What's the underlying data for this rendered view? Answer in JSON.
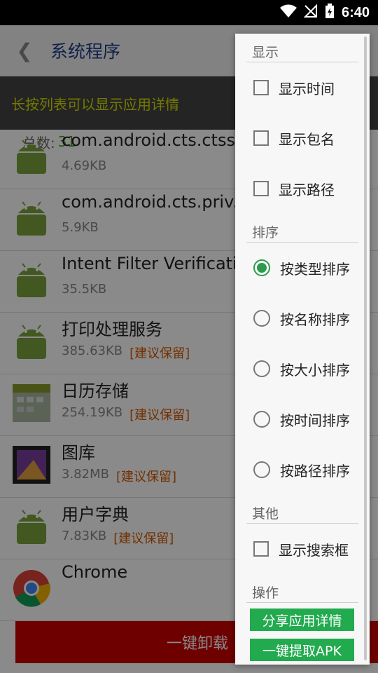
{
  "status_bar": {
    "time": "6:40"
  },
  "toolbar": {
    "back_icon": "chevron-left-icon",
    "title": "系统程序"
  },
  "hint": "长按列表可以显示应用详情",
  "count": {
    "label": "总数:",
    "value": "31"
  },
  "apps": [
    {
      "name": "com.android.cts.ctss",
      "size": "4.69KB",
      "tag": "",
      "icon": "android-icon"
    },
    {
      "name": "com.android.cts.priv.",
      "size": "5.9KB",
      "tag": "",
      "icon": "android-icon"
    },
    {
      "name": "Intent Filter Verificati",
      "size": "35.5KB",
      "tag": "",
      "icon": "android-icon"
    },
    {
      "name": "打印处理服务",
      "size": "385.63KB",
      "tag": "[建议保留]",
      "icon": "android-icon"
    },
    {
      "name": "日历存储",
      "size": "254.19KB",
      "tag": "[建议保留]",
      "icon": "calendar-icon"
    },
    {
      "name": "图库",
      "size": "3.82MB",
      "tag": "[建议保留]",
      "icon": "gallery-icon"
    },
    {
      "name": "用户字典",
      "size": "7.83KB",
      "tag": "[建议保留]",
      "icon": "android-icon"
    },
    {
      "name": "Chrome",
      "size": "",
      "tag": "",
      "icon": "chrome-icon"
    }
  ],
  "uninstall_button": "一键卸载",
  "menu": {
    "display_header": "显示",
    "display_options": [
      "显示时间",
      "显示包名",
      "显示路径"
    ],
    "sort_header": "排序",
    "sort_options": [
      "按类型排序",
      "按名称排序",
      "按大小排序",
      "按时间排序",
      "按路径排序"
    ],
    "sort_selected": 0,
    "other_header": "其他",
    "other_options": [
      "显示搜索框"
    ],
    "ops_header": "操作",
    "ops_buttons": [
      "分享应用详情",
      "一键提取APK"
    ]
  }
}
